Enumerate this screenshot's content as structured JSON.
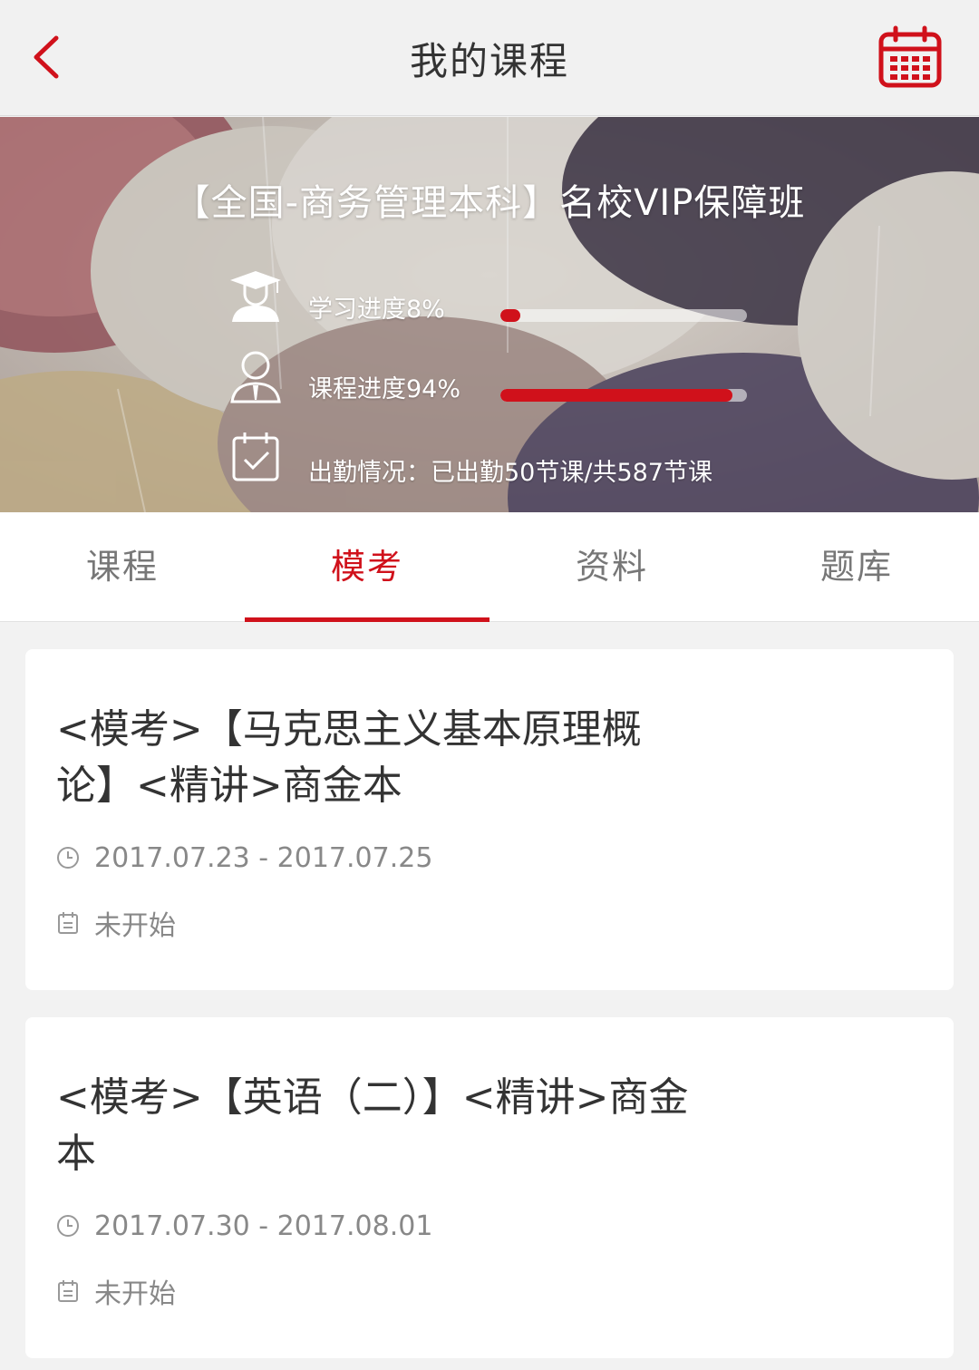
{
  "header": {
    "title": "我的课程",
    "back_icon": "chevron-left-icon",
    "calendar_icon": "calendar-icon",
    "accent_color": "#d0111b"
  },
  "banner": {
    "course_title": "【全国-商务管理本科】名校VIP保障班",
    "study_progress": {
      "label": "学习进度8%",
      "value": 0.08,
      "icon": "graduate-icon"
    },
    "course_progress": {
      "label": "课程进度94%",
      "value": 0.94,
      "icon": "teacher-icon"
    },
    "attendance": {
      "label": "出勤情况：已出勤50节课/共587节课",
      "icon": "calendar-check-icon"
    }
  },
  "tabs": [
    {
      "label": "课程",
      "active": false
    },
    {
      "label": "模考",
      "active": true
    },
    {
      "label": "资料",
      "active": false
    },
    {
      "label": "题库",
      "active": false
    }
  ],
  "exams": [
    {
      "title": "<模考>【马克思主义基本原理概论】<精讲>商金本",
      "date_range": "2017.07.23 - 2017.07.25",
      "status": "未开始"
    },
    {
      "title": "<模考>【英语（二）】<精讲>商金本",
      "date_range": "2017.07.30 - 2017.08.01",
      "status": "未开始"
    }
  ]
}
